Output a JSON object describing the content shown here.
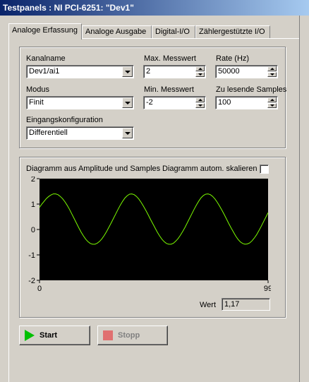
{
  "window": {
    "title": "Testpanels : NI PCI-6251: \"Dev1\""
  },
  "tabs": [
    {
      "label": "Analoge Erfassung",
      "active": true
    },
    {
      "label": "Analoge Ausgabe"
    },
    {
      "label": "Digital-I/O"
    },
    {
      "label": "Zählergestützte I/O"
    }
  ],
  "settings": {
    "channel_label": "Kanalname",
    "channel_value": "Dev1/ai1",
    "max_label": "Max. Messwert",
    "max_value": "2",
    "rate_label": "Rate (Hz)",
    "rate_value": "50000",
    "mode_label": "Modus",
    "mode_value": "Finit",
    "min_label": "Min. Messwert",
    "min_value": "-2",
    "samples_label": "Zu lesende Samples",
    "samples_value": "100",
    "input_config_label": "Eingangskonfiguration",
    "input_config_value": "Differentiell"
  },
  "graph": {
    "title": "Diagramm aus Amplitude und Samples",
    "autoscale_label": "Diagramm autom. skalieren",
    "autoscale_checked": false,
    "value_label": "Wert",
    "value": "1,17"
  },
  "chart_data": {
    "type": "line",
    "xlim": [
      0,
      99
    ],
    "ylim": [
      -2,
      2
    ],
    "x_ticks": [
      "0",
      "99"
    ],
    "y_ticks": [
      "2",
      "1",
      "0",
      "-1",
      "-2"
    ],
    "grid": false,
    "background": "#000000",
    "series": [
      {
        "color": "#7cfc00",
        "values": [
          0.87,
          1.0,
          1.11,
          1.22,
          1.3,
          1.36,
          1.4,
          1.4,
          1.37,
          1.3,
          1.21,
          1.09,
          0.95,
          0.79,
          0.61,
          0.43,
          0.25,
          0.07,
          -0.1,
          -0.25,
          -0.38,
          -0.48,
          -0.55,
          -0.58,
          -0.58,
          -0.54,
          -0.47,
          -0.37,
          -0.24,
          -0.09,
          0.08,
          0.25,
          0.43,
          0.61,
          0.79,
          0.96,
          1.11,
          1.24,
          1.33,
          1.39,
          1.4,
          1.37,
          1.3,
          1.2,
          1.07,
          0.92,
          0.76,
          0.59,
          0.41,
          0.24,
          0.07,
          -0.1,
          -0.25,
          -0.38,
          -0.48,
          -0.55,
          -0.58,
          -0.58,
          -0.54,
          -0.46,
          -0.36,
          -0.23,
          -0.08,
          0.08,
          0.26,
          0.44,
          0.62,
          0.8,
          0.97,
          1.12,
          1.25,
          1.34,
          1.39,
          1.4,
          1.37,
          1.3,
          1.2,
          1.07,
          0.92,
          0.76,
          0.59,
          0.41,
          0.23,
          0.06,
          -0.1,
          -0.26,
          -0.39,
          -0.49,
          -0.55,
          -0.58,
          -0.57,
          -0.53,
          -0.45,
          -0.34,
          -0.21,
          -0.05,
          0.12,
          0.3,
          0.48,
          0.66
        ]
      }
    ]
  },
  "buttons": {
    "start_label": "Start",
    "stop_label": "Stopp"
  },
  "colors": {
    "start_icon": "#00c000",
    "stop_icon": "#e07070"
  }
}
